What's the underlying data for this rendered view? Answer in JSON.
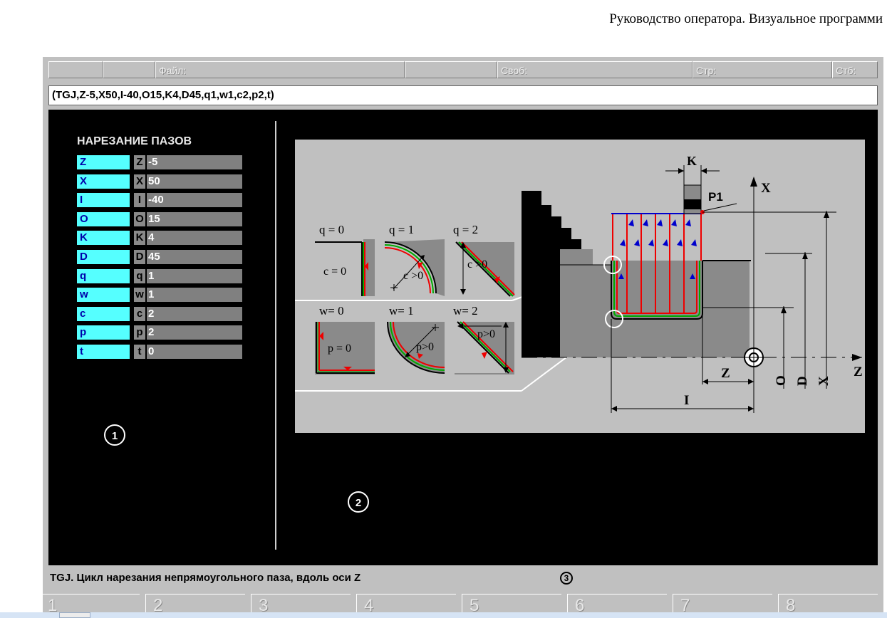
{
  "document_header": "Руководство оператора. Визуальное программи",
  "status_bar": {
    "file_label": "Файл:",
    "free_label": "Своб:",
    "page_label": "Стр:",
    "column_label": "Стб:"
  },
  "command_line": "(TGJ,Z-5,X50,I-40,O15,K4,D45,q1,w1,c2,p2,t)",
  "panel": {
    "title": "НАРЕЗАНИЕ ПАЗОВ",
    "params": [
      {
        "name": "Z",
        "short": "Z",
        "value": "-5"
      },
      {
        "name": "X",
        "short": "X",
        "value": "50"
      },
      {
        "name": "I",
        "short": "I",
        "value": "-40"
      },
      {
        "name": "O",
        "short": "O",
        "value": "15"
      },
      {
        "name": "K",
        "short": "K",
        "value": "4"
      },
      {
        "name": "D",
        "short": "D",
        "value": "45"
      },
      {
        "name": "q",
        "short": "q",
        "value": "1"
      },
      {
        "name": "w",
        "short": "w",
        "value": "1"
      },
      {
        "name": "c",
        "short": "c",
        "value": "2"
      },
      {
        "name": "p",
        "short": "p",
        "value": "2"
      },
      {
        "name": "t",
        "short": "t",
        "value": "0"
      }
    ]
  },
  "callouts": {
    "one": "1",
    "two": "2",
    "three": "3"
  },
  "diagram": {
    "q0": "q = 0",
    "q1": "q = 1",
    "q2": "q = 2",
    "c0": "c = 0",
    "c_gt1": "c >0",
    "c_gt2": "c >0",
    "w0": "w= 0",
    "w1": "w= 1",
    "w2": "w= 2",
    "p0": "p = 0",
    "p_gt1": "p>0",
    "p_gt2": "p>0",
    "K": "K",
    "P1": "P1",
    "X_axis": "X",
    "Z_axis": "Z",
    "Z_dim": "Z",
    "I_dim": "I",
    "O_dim": "O",
    "D_dim": "D",
    "X_dim": "X"
  },
  "hint": "TGJ. Цикл нарезания непрямоугольного паза, вдоль оси Z",
  "fkeys": [
    "1",
    "2",
    "3",
    "4",
    "5",
    "6",
    "7",
    "8"
  ],
  "colors": {
    "param_bg": "#55ffff",
    "param_text": "#0000aa",
    "value_bg": "#808080",
    "screen_bg": "#000000",
    "panel_bg": "#c0c0c0"
  }
}
